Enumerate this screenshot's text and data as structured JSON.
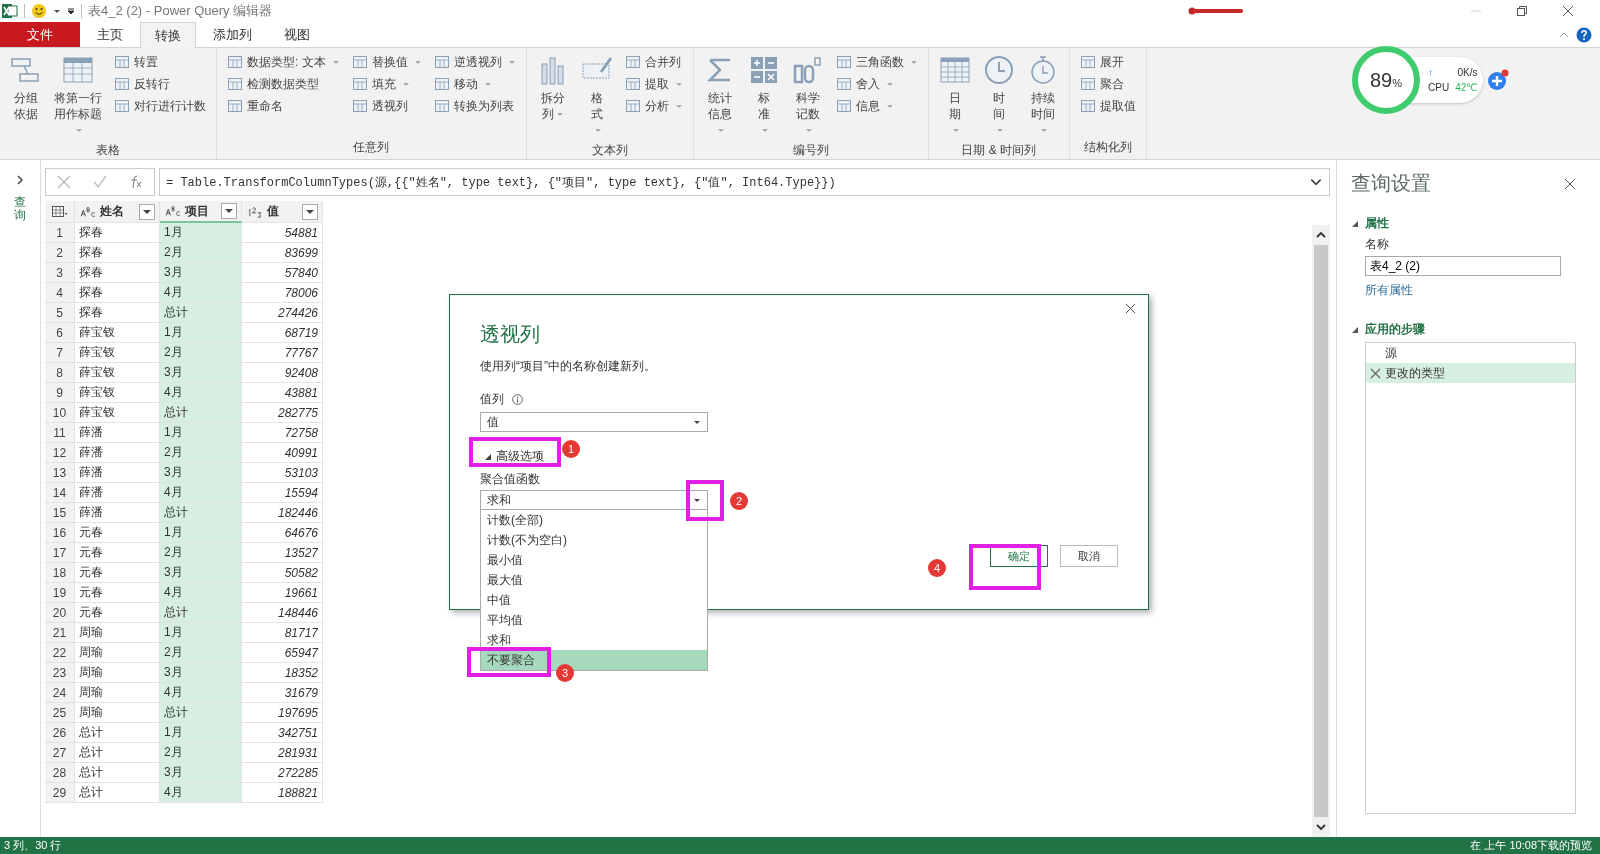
{
  "window": {
    "title": "表4_2 (2) - Power Query 编辑器"
  },
  "ribbon_tabs": [
    {
      "label": "文件",
      "kind": "file",
      "selected": false
    },
    {
      "label": "主页",
      "kind": "tab",
      "selected": false
    },
    {
      "label": "转换",
      "kind": "tab",
      "selected": true
    },
    {
      "label": "添加列",
      "kind": "tab",
      "selected": false
    },
    {
      "label": "视图",
      "kind": "tab",
      "selected": false
    }
  ],
  "ribbon_groups": [
    {
      "label": "表格",
      "items": [
        {
          "kind": "large",
          "label": "分组依据",
          "dropdown": false
        },
        {
          "kind": "large",
          "label": "将第一行用作标题",
          "dropdown": true
        },
        {
          "kind": "column",
          "items": [
            {
              "label": "转置",
              "dropdown": false
            },
            {
              "label": "反转行",
              "dropdown": false
            },
            {
              "label": "对行进行计数",
              "dropdown": false
            }
          ]
        }
      ]
    },
    {
      "label": "任意列",
      "items": [
        {
          "kind": "column",
          "items": [
            {
              "label": "数据类型: 文本",
              "dropdown": true
            },
            {
              "label": "检测数据类型",
              "dropdown": false
            },
            {
              "label": "重命名",
              "dropdown": false
            }
          ]
        },
        {
          "kind": "column",
          "items": [
            {
              "label": "替换值",
              "dropdown": true
            },
            {
              "label": "填充",
              "dropdown": true
            },
            {
              "label": "透视列",
              "dropdown": false
            }
          ]
        },
        {
          "kind": "column",
          "items": [
            {
              "label": "逆透视列",
              "dropdown": true
            },
            {
              "label": "移动",
              "dropdown": true
            },
            {
              "label": "转换为列表",
              "dropdown": false
            }
          ]
        }
      ]
    },
    {
      "label": "文本列",
      "items": [
        {
          "kind": "large",
          "label": "拆分列",
          "dropdown": true
        },
        {
          "kind": "large",
          "label": "格式",
          "dropdown": true
        },
        {
          "kind": "column",
          "items": [
            {
              "label": "合并列",
              "dropdown": false
            },
            {
              "label": "提取",
              "dropdown": true
            },
            {
              "label": "分析",
              "dropdown": true
            }
          ]
        }
      ]
    },
    {
      "label": "编号列",
      "items": [
        {
          "kind": "large",
          "label": "统计信息",
          "dropdown": true
        },
        {
          "kind": "large",
          "label": "标准",
          "dropdown": true
        },
        {
          "kind": "large",
          "label": "科学记数",
          "dropdown": true
        },
        {
          "kind": "column",
          "items": [
            {
              "label": "三角函数",
              "dropdown": true
            },
            {
              "label": "舍入",
              "dropdown": true
            },
            {
              "label": "信息",
              "dropdown": true
            }
          ]
        }
      ]
    },
    {
      "label": "日期 & 时间列",
      "items": [
        {
          "kind": "large",
          "label": "日期",
          "dropdown": true
        },
        {
          "kind": "large",
          "label": "时间",
          "dropdown": true
        },
        {
          "kind": "large",
          "label": "持续时间",
          "dropdown": true
        }
      ]
    },
    {
      "label": "结构化列",
      "items": [
        {
          "kind": "column",
          "items": [
            {
              "label": "展开",
              "dropdown": false
            },
            {
              "label": "聚合",
              "dropdown": false
            },
            {
              "label": "提取值",
              "dropdown": false
            }
          ]
        }
      ]
    }
  ],
  "monitor": {
    "percent": "89",
    "unit": "%",
    "upload": "↑",
    "speed": "0K/s",
    "cpu_label": "CPU",
    "cpu_temp": "42℃"
  },
  "nav": {
    "label": "查询"
  },
  "formula_bar": {
    "formula": "= Table.TransformColumnTypes(源,{{\"姓名\", type text}, {\"项目\", type text}, {\"值\", Int64.Type}})"
  },
  "table": {
    "columns": [
      {
        "name": "姓名",
        "kind": "text",
        "selected": false
      },
      {
        "name": "项目",
        "kind": "text",
        "selected": true
      },
      {
        "name": "值",
        "kind": "number",
        "selected": false
      }
    ],
    "rows": [
      [
        "1",
        "探春",
        "1月",
        "54881"
      ],
      [
        "2",
        "探春",
        "2月",
        "83699"
      ],
      [
        "3",
        "探春",
        "3月",
        "57840"
      ],
      [
        "4",
        "探春",
        "4月",
        "78006"
      ],
      [
        "5",
        "探春",
        "总计",
        "274426"
      ],
      [
        "6",
        "薛宝钗",
        "1月",
        "68719"
      ],
      [
        "7",
        "薛宝钗",
        "2月",
        "77767"
      ],
      [
        "8",
        "薛宝钗",
        "3月",
        "92408"
      ],
      [
        "9",
        "薛宝钗",
        "4月",
        "43881"
      ],
      [
        "10",
        "薛宝钗",
        "总计",
        "282775"
      ],
      [
        "11",
        "薛潘",
        "1月",
        "72758"
      ],
      [
        "12",
        "薛潘",
        "2月",
        "40991"
      ],
      [
        "13",
        "薛潘",
        "3月",
        "53103"
      ],
      [
        "14",
        "薛潘",
        "4月",
        "15594"
      ],
      [
        "15",
        "薛潘",
        "总计",
        "182446"
      ],
      [
        "16",
        "元春",
        "1月",
        "64676"
      ],
      [
        "17",
        "元春",
        "2月",
        "13527"
      ],
      [
        "18",
        "元春",
        "3月",
        "50582"
      ],
      [
        "19",
        "元春",
        "4月",
        "19661"
      ],
      [
        "20",
        "元春",
        "总计",
        "148446"
      ],
      [
        "21",
        "周瑜",
        "1月",
        "81717"
      ],
      [
        "22",
        "周瑜",
        "2月",
        "65947"
      ],
      [
        "23",
        "周瑜",
        "3月",
        "18352"
      ],
      [
        "24",
        "周瑜",
        "4月",
        "31679"
      ],
      [
        "25",
        "周瑜",
        "总计",
        "197695"
      ],
      [
        "26",
        "总计",
        "1月",
        "342751"
      ],
      [
        "27",
        "总计",
        "2月",
        "281931"
      ],
      [
        "28",
        "总计",
        "3月",
        "272285"
      ],
      [
        "29",
        "总计",
        "4月",
        "188821"
      ]
    ]
  },
  "query_settings": {
    "title": "查询设置",
    "properties_heading": "属性",
    "name_label": "名称",
    "name_value": "表4_2 (2)",
    "all_properties_link": "所有属性",
    "steps_heading": "应用的步骤",
    "steps": [
      {
        "label": "源",
        "selected": false
      },
      {
        "label": "更改的类型",
        "selected": true
      }
    ]
  },
  "dialog": {
    "title": "透视列",
    "description": "使用列“项目”中的名称创建新列。",
    "value_column_label": "值列",
    "value_column": "值",
    "advanced_toggle": "高级选项",
    "advanced_expanded": true,
    "aggregate_label": "聚合值函数",
    "aggregate_value": "求和",
    "aggregate_options": [
      {
        "label": "计数(全部)",
        "selected": false
      },
      {
        "label": "计数(不为空白)",
        "selected": false
      },
      {
        "label": "最小值",
        "selected": false
      },
      {
        "label": "最大值",
        "selected": false
      },
      {
        "label": "中值",
        "selected": false
      },
      {
        "label": "平均值",
        "selected": false
      },
      {
        "label": "求和",
        "selected": false
      },
      {
        "label": "不要聚合",
        "selected": true
      }
    ],
    "ok_button": "确定",
    "cancel_button": "取消"
  },
  "annotations": [
    {
      "number": "1"
    },
    {
      "number": "2"
    },
    {
      "number": "3"
    },
    {
      "number": "4"
    }
  ],
  "status_bar": {
    "left": "3 列、30 行",
    "right": "在 上午 10:08下载的预览"
  }
}
